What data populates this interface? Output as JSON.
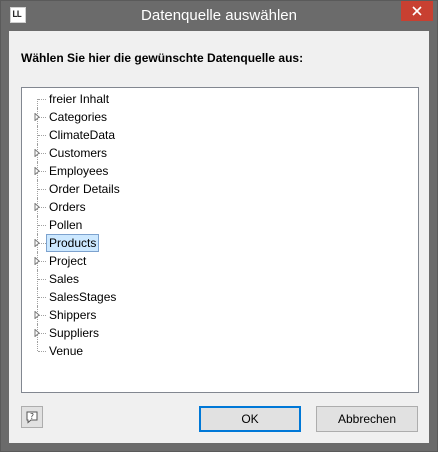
{
  "window": {
    "title": "Datenquelle auswählen",
    "app_icon_text": "LL"
  },
  "prompt": "Wählen Sie hier die gewünschte Datenquelle aus:",
  "tree": {
    "items": [
      {
        "label": "freier Inhalt",
        "expandable": false,
        "selected": false
      },
      {
        "label": "Categories",
        "expandable": true,
        "selected": false
      },
      {
        "label": "ClimateData",
        "expandable": false,
        "selected": false
      },
      {
        "label": "Customers",
        "expandable": true,
        "selected": false
      },
      {
        "label": "Employees",
        "expandable": true,
        "selected": false
      },
      {
        "label": "Order Details",
        "expandable": false,
        "selected": false
      },
      {
        "label": "Orders",
        "expandable": true,
        "selected": false
      },
      {
        "label": "Pollen",
        "expandable": false,
        "selected": false
      },
      {
        "label": "Products",
        "expandable": true,
        "selected": true
      },
      {
        "label": "Project",
        "expandable": true,
        "selected": false
      },
      {
        "label": "Sales",
        "expandable": false,
        "selected": false
      },
      {
        "label": "SalesStages",
        "expandable": false,
        "selected": false
      },
      {
        "label": "Shippers",
        "expandable": true,
        "selected": false
      },
      {
        "label": "Suppliers",
        "expandable": true,
        "selected": false
      },
      {
        "label": "Venue",
        "expandable": false,
        "selected": false
      }
    ]
  },
  "buttons": {
    "ok": "OK",
    "cancel": "Abbrechen",
    "help_icon": "help-icon"
  },
  "colors": {
    "titlebar": "#6b6b6b",
    "close": "#c84031",
    "selection": "#cce8ff",
    "default_button_border": "#0078d7"
  }
}
